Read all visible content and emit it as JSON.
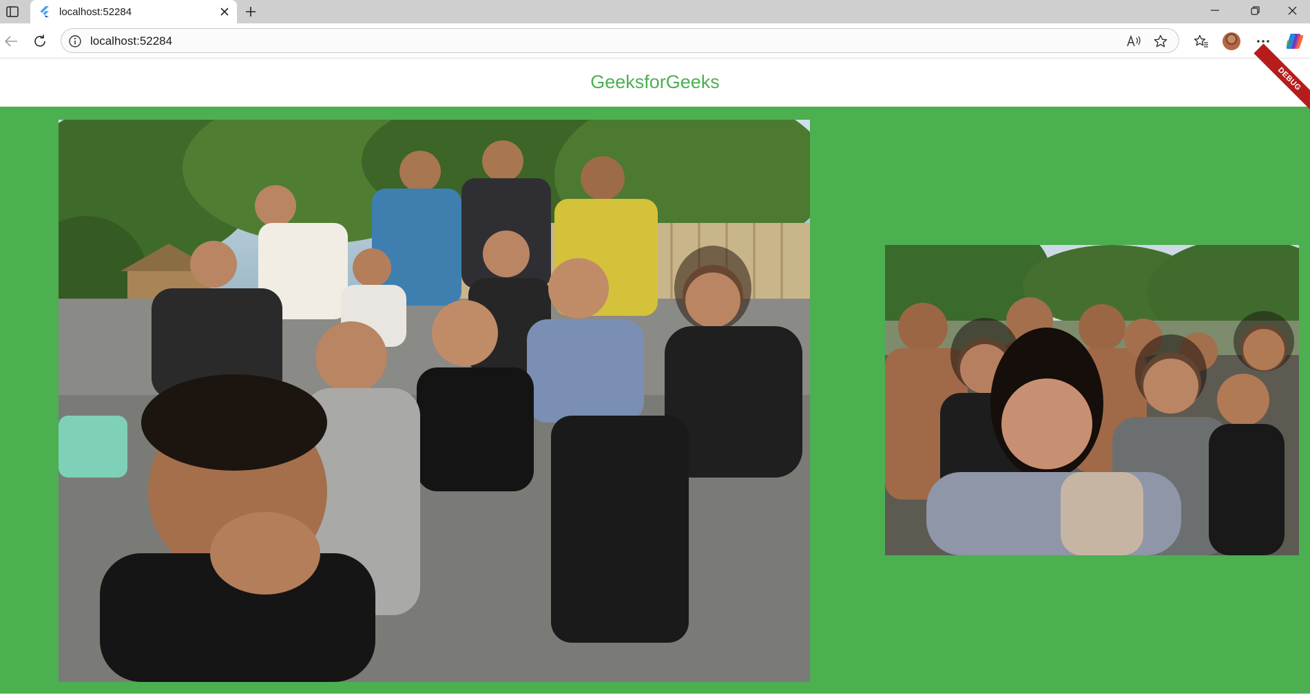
{
  "browser": {
    "tab_title": "localhost:52284",
    "url": "localhost:52284",
    "icons": {
      "sidebar": "sidebar-icon",
      "favicon": "flutter-icon",
      "tab_close": "close-icon",
      "new_tab": "plus-icon",
      "minimize": "minimize-icon",
      "restore": "restore-icon",
      "close": "close-icon",
      "back": "back-icon",
      "refresh": "refresh-icon",
      "info": "info-icon",
      "read_aloud": "read-aloud-icon",
      "favorite": "star-icon",
      "favorites": "favorites-icon",
      "profile": "avatar",
      "more": "more-icon",
      "copilot": "copilot-icon"
    }
  },
  "app": {
    "title": "GeeksforGeeks",
    "debug_banner": "DEBUG",
    "colors": {
      "primary": "#4caf50",
      "appbar_bg": "#ffffff",
      "debug": "#b71c1c"
    },
    "images": [
      {
        "name": "group-selfie-beach-seated"
      },
      {
        "name": "group-selfie-beach-standing"
      }
    ]
  }
}
